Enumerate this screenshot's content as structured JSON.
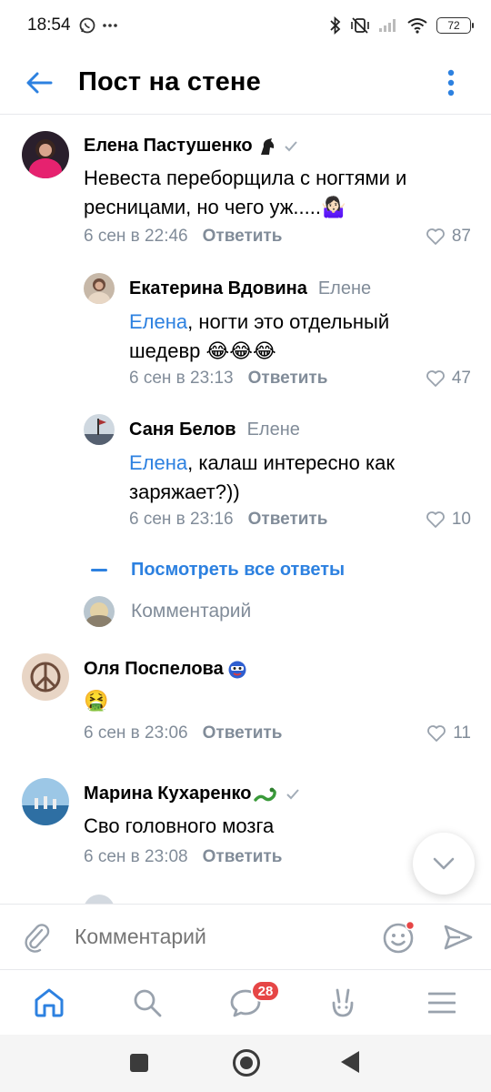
{
  "status_bar": {
    "time": "18:54",
    "battery": "72"
  },
  "header": {
    "title": "Пост на стене"
  },
  "comments": [
    {
      "author": "Елена Пастушенко",
      "author_badge_icon": "horse-head-icon",
      "verified": true,
      "text": "Невеста переборщила с ногтями и ресницами, но чего уж.....",
      "text_emoji": "🤷🏻‍♀️",
      "date": "6 сен в 22:46",
      "reply_label": "Ответить",
      "likes": "87"
    },
    {
      "author": "Екатерина Вдовина",
      "reply_to": "Елене",
      "mention": "Елена",
      "text": ", ногти это отдельный шедевр",
      "text_emoji": "😂😂😂",
      "date": "6 сен в 23:13",
      "reply_label": "Ответить",
      "likes": "47"
    },
    {
      "author": "Саня Белов",
      "reply_to": "Елене",
      "mention": "Елена",
      "text": ", калаш интересно как заряжает?))",
      "date": "6 сен в 23:16",
      "reply_label": "Ответить",
      "likes": "10"
    },
    {
      "author": "Оля Поспелова",
      "author_badge_icon": "masked-face-icon",
      "text_emoji": "🤮",
      "date": "6 сен в 23:06",
      "reply_label": "Ответить",
      "likes": "11"
    },
    {
      "author": "Марина Кухаренко",
      "author_badge_icon": "snake-icon",
      "verified": true,
      "text": "Сво головного мозга",
      "date": "6 сен в 23:08",
      "reply_label": "Ответить"
    }
  ],
  "thread": {
    "show_all_label": "Посмотреть все ответы",
    "reply_placeholder": "Комментарий"
  },
  "composer": {
    "placeholder": "Комментарий"
  },
  "tabbar": {
    "messages_badge": "28"
  },
  "colors": {
    "accent": "#2d81e0",
    "secondary_text": "#818c99",
    "badge": "#e64646"
  }
}
